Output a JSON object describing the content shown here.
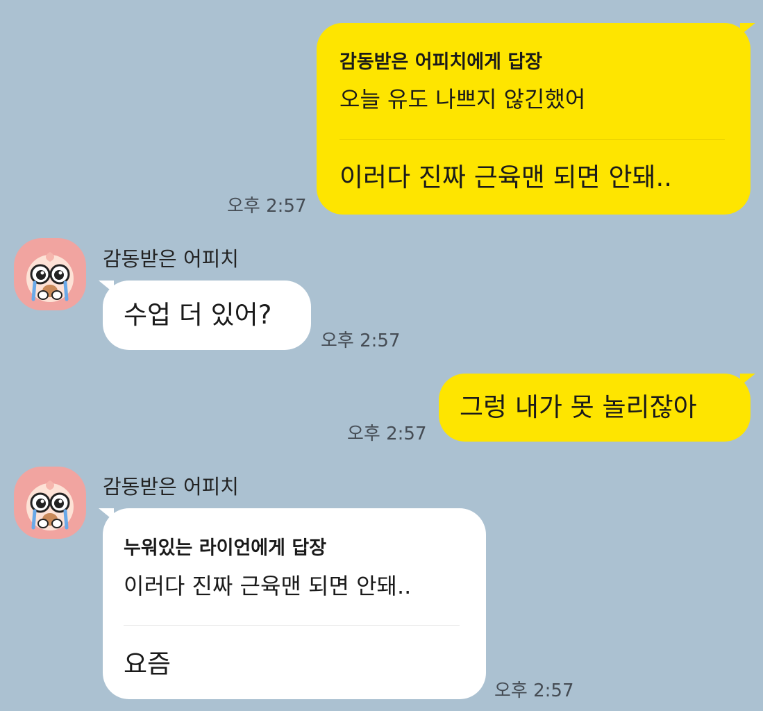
{
  "colors": {
    "background": "#abc1d1",
    "my_bubble": "#fee500",
    "their_bubble": "#ffffff"
  },
  "messages": [
    {
      "reply_title": "감동받은 어피치에게 답장",
      "reply_quote": "오늘 유도 나쁘지 않긴했어",
      "text": "이러다 진짜 근육맨 되면 안돼..",
      "time": "오후 2:57"
    },
    {
      "sender": "감동받은 어피치",
      "avatar_icon": "apeach-crying-icon",
      "text": "수업 더 있어?",
      "time": "오후 2:57"
    },
    {
      "text": "그렁 내가 못 놀리잖아",
      "time": "오후 2:57"
    },
    {
      "sender": "감동받은 어피치",
      "avatar_icon": "apeach-crying-icon",
      "reply_title": "누워있는 라이언에게 답장",
      "reply_quote": "이러다 진짜 근육맨 되면 안돼..",
      "text": "요즘",
      "time": "오후 2:57"
    }
  ]
}
